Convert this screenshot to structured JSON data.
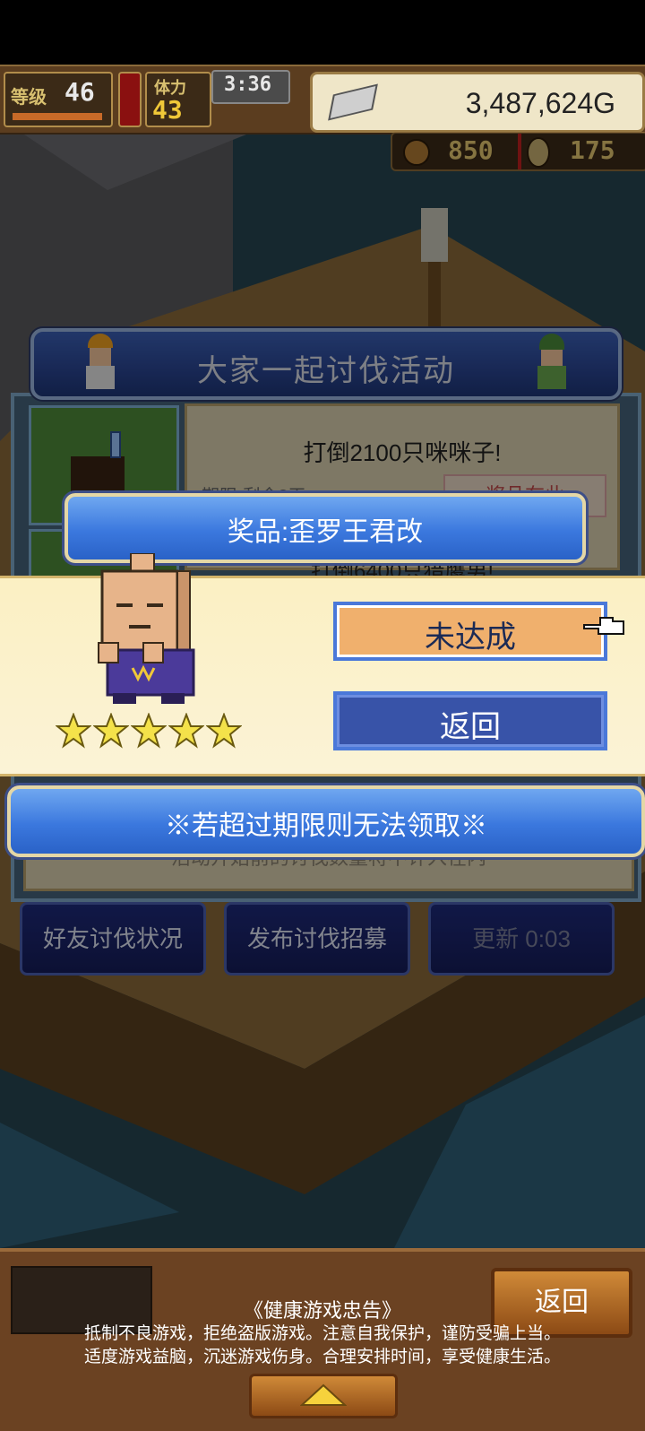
{
  "hud": {
    "level_label": "等级",
    "level_value": "46",
    "stamina_label": "体力",
    "stamina_value": "43",
    "timer": "3:36",
    "gold": "3,487,624G",
    "currency1": "850",
    "currency2": "175"
  },
  "event": {
    "title": "大家一起讨伐活动",
    "quest1": "打倒2100只咪咪子!",
    "deadline": "期限:剩余3天",
    "reward_location": "奖品在此",
    "quest2": "打倒6400只猎鹰男!",
    "note": "活动开始前的讨伐数量将不计入在内"
  },
  "popup": {
    "prize_title": "奖品:歪罗王君改",
    "unachieved_label": "未达成",
    "back_label": "返回",
    "rating_stars": 5
  },
  "warning": "※若超过期限则无法领取※",
  "actions": {
    "friends": "好友讨伐状况",
    "recruit": "发布讨伐招募",
    "refresh": "更新 0:03"
  },
  "footer": {
    "back_label": "返回",
    "advice_title": "《健康游戏忠告》",
    "advice_line1": "抵制不良游戏，拒绝盗版游戏。注意自我保护，谨防受骗上当。",
    "advice_line2": "适度游戏益脑，沉迷游戏伤身。合理安排时间，享受健康生活。"
  },
  "colors": {
    "accent_blue": "#3b78de",
    "unachieved_orange": "#f0b06d",
    "popup_cream": "#fbf0c3"
  }
}
